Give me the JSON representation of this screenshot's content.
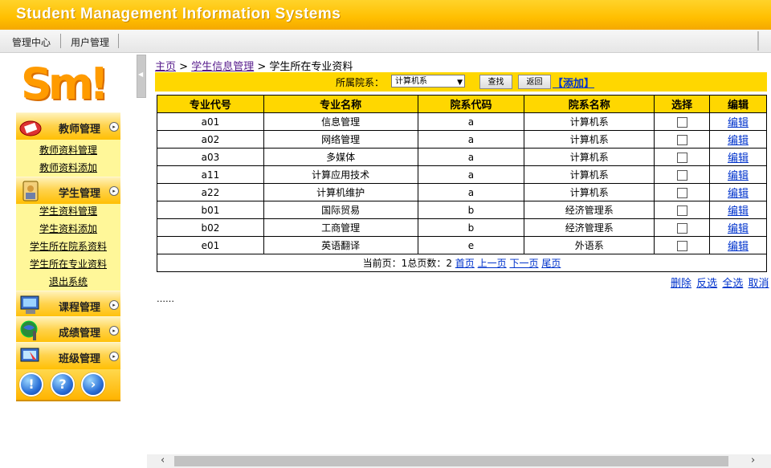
{
  "app": {
    "title": "Student Management Information Systems"
  },
  "topnav": {
    "items": [
      "管理中心",
      "用户管理"
    ]
  },
  "logo": {
    "text": "Sm!"
  },
  "sidebar": {
    "sections": [
      {
        "label": "教师管理",
        "icon": "teacher-icon",
        "links": [
          "教师资料管理",
          "教师资料添加"
        ]
      },
      {
        "label": "学生管理",
        "icon": "student-icon",
        "links": [
          "学生资料管理",
          "学生资料添加",
          "学生所在院系资料",
          "学生所在专业资料",
          "退出系统"
        ]
      },
      {
        "label": "课程管理",
        "icon": "course-icon",
        "links": []
      },
      {
        "label": "成绩管理",
        "icon": "grade-icon",
        "links": []
      },
      {
        "label": "班级管理",
        "icon": "class-icon",
        "links": []
      }
    ],
    "bottom_icons": [
      "info-icon",
      "help-icon",
      "next-icon"
    ]
  },
  "breadcrumb": {
    "home": "主页",
    "sep": ">",
    "parent": "学生信息管理",
    "current": "学生所在专业资料"
  },
  "filter": {
    "label": "所属院系：",
    "selected": "计算机系",
    "search_label": "查找",
    "back_label": "返回",
    "add_label": "【添加】"
  },
  "table": {
    "headers": [
      "专业代号",
      "专业名称",
      "院系代码",
      "院系名称",
      "选择",
      "编辑"
    ],
    "rows": [
      [
        "a01",
        "信息管理",
        "a",
        "计算机系"
      ],
      [
        "a02",
        "网络管理",
        "a",
        "计算机系"
      ],
      [
        "a03",
        "多媒体",
        "a",
        "计算机系"
      ],
      [
        "a11",
        "计算应用技术",
        "a",
        "计算机系"
      ],
      [
        "a22",
        "计算机维护",
        "a",
        "计算机系"
      ],
      [
        "b01",
        "国际贸易",
        "b",
        "经济管理系"
      ],
      [
        "b02",
        "工商管理",
        "b",
        "经济管理系"
      ],
      [
        "e01",
        "英语翻译",
        "e",
        "外语系"
      ]
    ],
    "edit_label": "编辑"
  },
  "pager": {
    "current_label": "当前页：",
    "current": "1",
    "total_label": "总页数：",
    "total": "2",
    "first": "首页",
    "prev": "上一页",
    "next": "下一页",
    "last": "尾页"
  },
  "actions": {
    "delete": "删除",
    "invert": "反选",
    "select_all": "全选",
    "cancel": "取消"
  },
  "footer_dots": "……",
  "colors": {
    "banner": "#ffbf00",
    "table_header": "#ffd700",
    "menu_body": "#fff799",
    "link": "#0033cc"
  }
}
